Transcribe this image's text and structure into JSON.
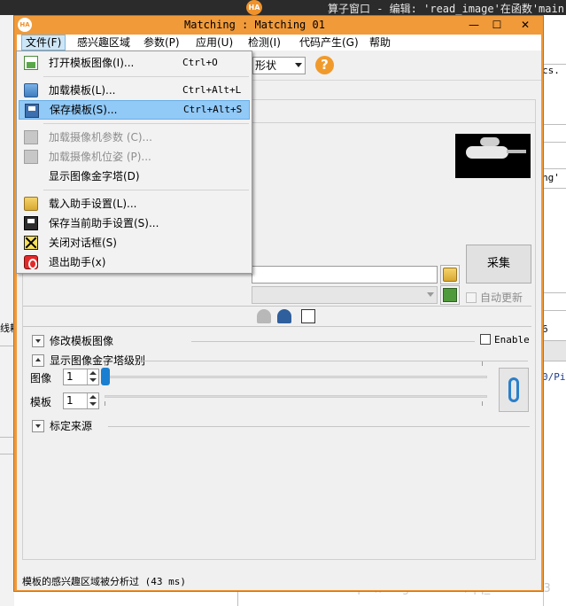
{
  "background_app": {
    "title": "算子窗口 - 编辑: 'read_image'在函数'main'的",
    "logo": "HA",
    "right_snippets": [
      "cs.",
      "ng'",
      "6",
      "0/Pi"
    ],
    "left_snippet": "线耗"
  },
  "watermark": "https://blog.csdn.net/qq_29885583",
  "window": {
    "title": "Matching : Matching 01",
    "icon_text": "HA",
    "minimize": "—",
    "maximize": "☐",
    "close": "✕"
  },
  "menubar": [
    "文件(F)",
    "感兴趣区域",
    "参数(P)",
    "应用(U)",
    "检测(I)",
    "代码产生(G)",
    "帮助"
  ],
  "toolbar": {
    "shape_value": "形状",
    "help_icon": "?"
  },
  "panel": {
    "acquire_button": "采集",
    "auto_update": "自动更新",
    "modify_template": "修改模板图像",
    "enable": "Enable",
    "show_pyramid": "显示图像金字塔级别",
    "image_label": "图像",
    "image_value": "1",
    "template_label": "模板",
    "template_value": "1",
    "template_source": "标定来源"
  },
  "status": "模板的感兴趣区域被分析过 (43 ms)",
  "file_menu": {
    "items": [
      {
        "label": "打开模板图像(I)...",
        "shortcut": "Ctrl+O",
        "icon": "open-image-icon",
        "state": "normal"
      },
      {
        "label": "加载模板(L)...",
        "shortcut": "Ctrl+Alt+L",
        "icon": "load-template-icon",
        "state": "normal"
      },
      {
        "label": "保存模板(S)...",
        "shortcut": "Ctrl+Alt+S",
        "icon": "save-disk-icon",
        "state": "hover"
      },
      {
        "label": "加载摄像机参数 (C)...",
        "shortcut": "",
        "icon": "camera-params-icon",
        "state": "disabled"
      },
      {
        "label": "加载摄像机位姿 (P)...",
        "shortcut": "",
        "icon": "camera-pose-icon",
        "state": "disabled"
      },
      {
        "label": "显示图像金字塔(D)",
        "shortcut": "",
        "icon": "",
        "state": "normal"
      },
      {
        "label": "载入助手设置(L)...",
        "shortcut": "",
        "icon": "folder-icon",
        "state": "normal"
      },
      {
        "label": "保存当前助手设置(S)...",
        "shortcut": "",
        "icon": "save-settings-icon",
        "state": "normal"
      },
      {
        "label": "关闭对话框(S)",
        "shortcut": "",
        "icon": "close-dialog-icon",
        "state": "normal"
      },
      {
        "label": "退出助手(x)",
        "shortcut": "",
        "icon": "exit-icon",
        "state": "normal"
      }
    ]
  },
  "colors": {
    "frame": "#f09a3a",
    "menu_hover": "#91c9f7",
    "slider_thumb": "#1a7fd0"
  }
}
